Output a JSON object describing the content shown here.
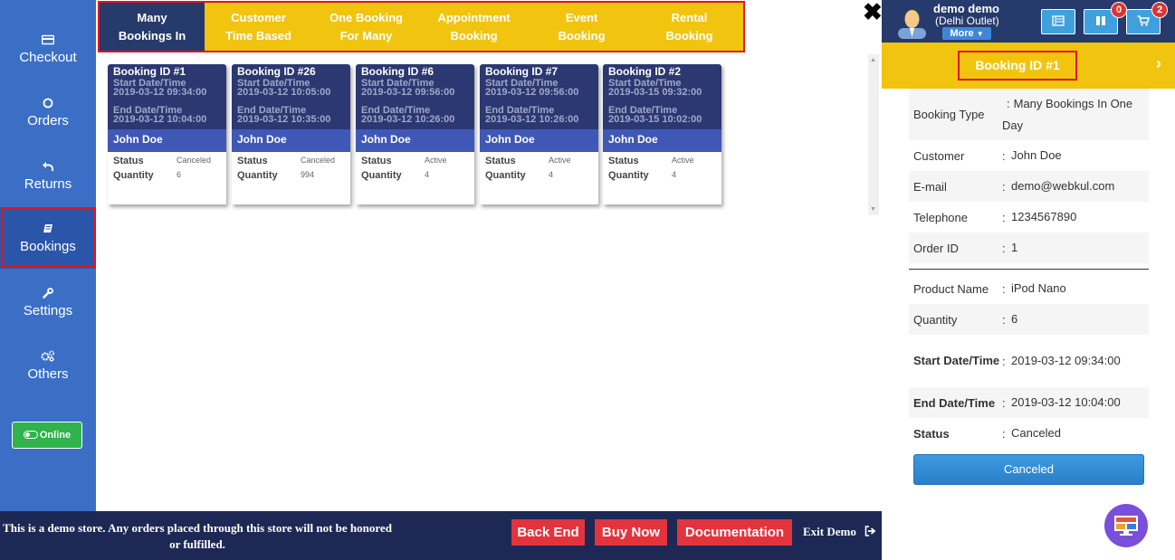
{
  "sidebar": {
    "items": [
      {
        "label": "Checkout",
        "icon": "card-icon"
      },
      {
        "label": "Orders",
        "icon": "circle-icon"
      },
      {
        "label": "Returns",
        "icon": "return-arrow-icon"
      },
      {
        "label": "Bookings",
        "icon": "book-icon"
      },
      {
        "label": "Settings",
        "icon": "wrench-icon"
      },
      {
        "label": "Others",
        "icon": "gears-icon"
      }
    ],
    "online_label": "Online"
  },
  "tabs": [
    {
      "line1": "Many",
      "line2": "Bookings In"
    },
    {
      "line1": "Customer",
      "line2": "Time Based"
    },
    {
      "line1": "One Booking",
      "line2": "For Many"
    },
    {
      "line1": "Appointment",
      "line2": "Booking"
    },
    {
      "line1": "Event",
      "line2": "Booking"
    },
    {
      "line1": "Rental",
      "line2": "Booking"
    }
  ],
  "cards": [
    {
      "title": "Booking ID #1",
      "start_label": "Start Date/Time",
      "start": "2019-03-12 09:34:00",
      "end_label": "End Date/Time",
      "end": "2019-03-12 10:04:00",
      "customer": "John Doe",
      "status_label": "Status",
      "status": "Canceled",
      "qty_label": "Quantity",
      "qty": "6"
    },
    {
      "title": "Booking ID #26",
      "start_label": "Start Date/Time",
      "start": "2019-03-12 10:05:00",
      "end_label": "End Date/Time",
      "end": "2019-03-12 10:35:00",
      "customer": "John Doe",
      "status_label": "Status",
      "status": "Canceled",
      "qty_label": "Quantity",
      "qty": "994"
    },
    {
      "title": "Booking ID #6",
      "start_label": "Start Date/Time",
      "start": "2019-03-12 09:56:00",
      "end_label": "End Date/Time",
      "end": "2019-03-12 10:26:00",
      "customer": "John Doe",
      "status_label": "Status",
      "status": "Active",
      "qty_label": "Quantity",
      "qty": "4"
    },
    {
      "title": "Booking ID #7",
      "start_label": "Start Date/Time",
      "start": "2019-03-12 09:56:00",
      "end_label": "End Date/Time",
      "end": "2019-03-12 10:26:00",
      "customer": "John Doe",
      "status_label": "Status",
      "status": "Active",
      "qty_label": "Quantity",
      "qty": "4"
    },
    {
      "title": "Booking ID #2",
      "start_label": "Start Date/Time",
      "start": "2019-03-15 09:32:00",
      "end_label": "End Date/Time",
      "end": "2019-03-15 10:02:00",
      "customer": "John Doe",
      "status_label": "Status",
      "status": "Active",
      "qty_label": "Quantity",
      "qty": "4"
    }
  ],
  "footer": {
    "message": "This is a demo store. Any orders placed through this store will not be honored or fulfilled.",
    "back_end": "Back End",
    "buy_now": "Buy Now",
    "documentation": "Documentation",
    "exit_demo": "Exit Demo"
  },
  "header": {
    "user_name": "demo demo",
    "outlet": "(Delhi Outlet)",
    "more": "More",
    "badge_hold": "0",
    "badge_cart": "2"
  },
  "detail": {
    "title": "Booking ID #1",
    "rows": [
      {
        "label": "Booking Type",
        "sep": ":",
        "value": "Many Bookings In One Day"
      },
      {
        "label": "Customer",
        "sep": ":",
        "value": "John Doe"
      },
      {
        "label": "E-mail",
        "sep": ":",
        "value": "demo@webkul.com"
      },
      {
        "label": "Telephone",
        "sep": ":",
        "value": "1234567890"
      },
      {
        "label": "Order ID",
        "sep": ":",
        "value": "1"
      }
    ],
    "rows2": [
      {
        "label": "Product Name",
        "sep": ":",
        "value": "iPod Nano"
      },
      {
        "label": "Quantity",
        "sep": ":",
        "value": "6"
      },
      {
        "label": "Start Date/Time",
        "sep": ":",
        "value": "2019-03-12 09:34:00"
      },
      {
        "label": "End Date/Time",
        "sep": ":",
        "value": "2019-03-12 10:04:00"
      },
      {
        "label": "Status",
        "sep": ":",
        "value": "Canceled"
      }
    ],
    "status_button": "Canceled"
  },
  "colors": {
    "sidebar": "#3b6fc6",
    "tab_bar": "#f1c40f",
    "active_tab": "#263a6b",
    "card_header": "#2c3872",
    "card_name": "#4058b5",
    "footer": "#1d2954",
    "footer_button": "#e3343e",
    "highlight_border": "#e5131d"
  }
}
